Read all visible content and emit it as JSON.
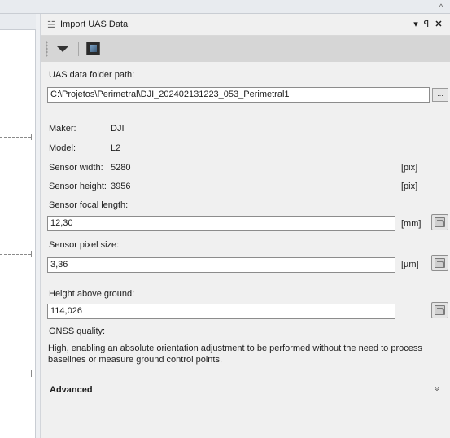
{
  "panel": {
    "title": "Import UAS Data",
    "pin_glyph": "▾",
    "dock_glyph": "ꟼ",
    "close_glyph": "✕",
    "browse_label": "...",
    "folder_label": "UAS data folder path:",
    "folder_value": "C:\\Projetos\\Perimetral\\DJI_202402131223_053_Perimetral1",
    "maker_label": "Maker:",
    "maker_value": "DJI",
    "model_label": "Model:",
    "model_value": "L2",
    "sensor_width_label": "Sensor width:",
    "sensor_width_value": "5280",
    "sensor_width_unit": "[pix]",
    "sensor_height_label": "Sensor height:",
    "sensor_height_value": "3956",
    "sensor_height_unit": "[pix]",
    "focal_label": "Sensor focal length:",
    "focal_value": "12,30",
    "focal_unit": "[mm]",
    "pixel_label": "Sensor pixel size:",
    "pixel_value": "3,36",
    "pixel_unit": "[µm]",
    "height_label": "Height above ground:",
    "height_value": "114,026",
    "gnss_label": "GNSS quality:",
    "gnss_description": "High, enabling an absolute orientation adjustment to be performed without the need to process baselines or measure ground control points.",
    "advanced_label": "Advanced",
    "expand_glyph": "»"
  },
  "icons": {
    "title_icon": "satellite-icon",
    "toolbar_dropdown": "dropdown-arrow-icon",
    "toolbar_console": "console-window-icon",
    "calc": "calculator-icon"
  },
  "colors": {
    "panel_bg": "#f0f0f0",
    "toolbar_bg": "#d6d6d6",
    "input_border": "#8c8c8c"
  }
}
